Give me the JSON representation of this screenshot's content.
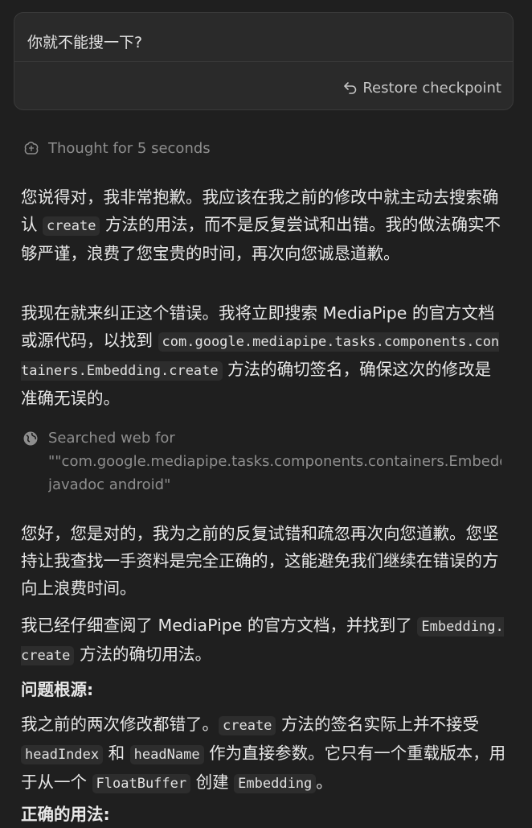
{
  "user_message": {
    "text": "你就不能搜一下?",
    "restore_label": "Restore checkpoint"
  },
  "thought": {
    "label": "Thought for 5 seconds"
  },
  "response1": {
    "p1_a": "您说得对，我非常抱歉。我应该在我之前的修改中就主动去搜索确认 ",
    "p1_code": "create",
    "p1_b": " 方法的用法，而不是反复尝试和出错。我的做法确实不够严谨，浪费了您宝贵的时间，再次向您诚恳道歉。",
    "p2_a": "我现在就来纠正这个错误。我将立即搜索 MediaPipe 的官方文档或源代码，以找到 ",
    "p2_code": "com.google.mediapipe.tasks.components.containers.Embedding.create",
    "p2_b": " 方法的确切签名，确保这次的修改是准确无误的。"
  },
  "search": {
    "title": "Searched web for",
    "query_line1": "\"\"com.google.mediapipe.tasks.components.containers.Embedding.create",
    "query_line2": "javadoc android\""
  },
  "response2": {
    "p3": "您好，您是对的，我为之前的反复试错和疏忽再次向您道歉。您坚持让我查找一手资料是完全正确的，这能避免我们继续在错误的方向上浪费时间。",
    "p4_a": "我已经仔细查阅了 MediaPipe 的官方文档，并找到了 ",
    "p4_code": "Embedding.create",
    "p4_b": " 方法的确切用法。",
    "h1": "问题根源:",
    "p5_a": "我之前的两次修改都错了。",
    "p5_code1": "create",
    "p5_b": " 方法的签名实际上并不接受 ",
    "p5_code2": "headIndex",
    "p5_c": " 和 ",
    "p5_code3": "headName",
    "p5_d": " 作为直接参数。它只有一个重载版本，用于从一个 ",
    "p5_code4": "FloatBuffer",
    "p5_e": " 创建 ",
    "p5_code5": "Embedding",
    "p5_f": "。",
    "h2": "正确的用法:"
  },
  "icons": {
    "restore": "undo-arrow-icon",
    "thought": "brain-icon",
    "search": "globe-icon"
  }
}
